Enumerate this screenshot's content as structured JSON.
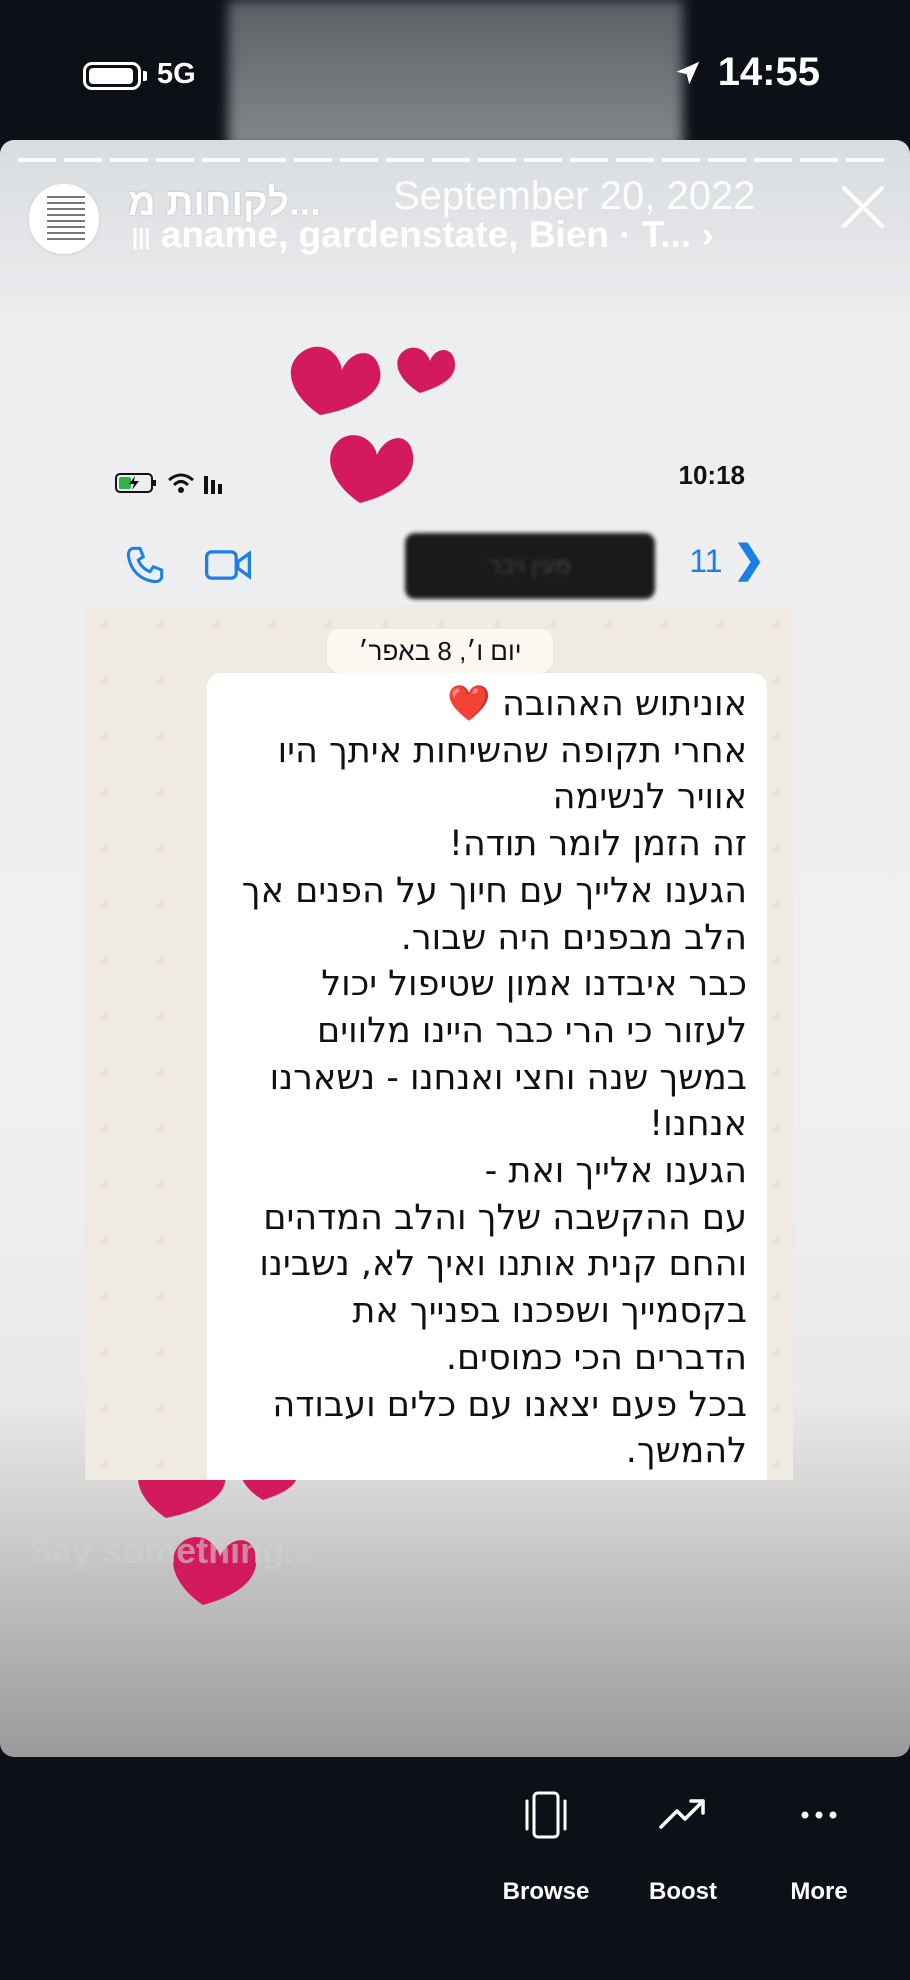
{
  "status_bar": {
    "network": "5G",
    "time": "14:55"
  },
  "story": {
    "title": "לקוחות מ...",
    "date": "September 20, 2022",
    "music": "aname, gardenstate, Bien · T... ›",
    "reply_placeholder": "Say something..."
  },
  "screenshot": {
    "phone_time": "10:18",
    "back_count": "11",
    "contact_name": "מעין ויבר",
    "date_chip": "יום ו׳, 8 באפר׳",
    "message_lines": [
      "אוניתוש האהובה ❤️",
      "אחרי תקופה שהשיחות איתך היו",
      "אוויר לנשימה",
      "זה הזמן לומר תודה!",
      "הגענו אלייך עם חיוך על הפנים אך",
      "הלב מבפנים היה שבור.",
      "כבר איבדנו אמון שטיפול יכול",
      "לעזור  כי הרי כבר היינו מלווים",
      "במשך שנה וחצי ואנחנו - נשארנו",
      "אנחנו!",
      "הגענו אלייך ואת -",
      "עם ההקשבה שלך והלב המדהים",
      "והחם קנית אותנו ואיך לא, נשבינו",
      "בקסמייך ושפכנו בפנייך את",
      "הדברים הכי כמוסים.",
      "בכל פעם יצאנו עם כלים ועבודה",
      "להמשך."
    ]
  },
  "bottom_actions": [
    {
      "label": "Browse",
      "icon": "browse-icon"
    },
    {
      "label": "Boost",
      "icon": "trending-up-icon"
    },
    {
      "label": "More",
      "icon": "more-dots-icon"
    }
  ],
  "colors": {
    "heart": "#d21a5c",
    "whatsapp_blue": "#1a80e5",
    "background": "#0d1117"
  }
}
